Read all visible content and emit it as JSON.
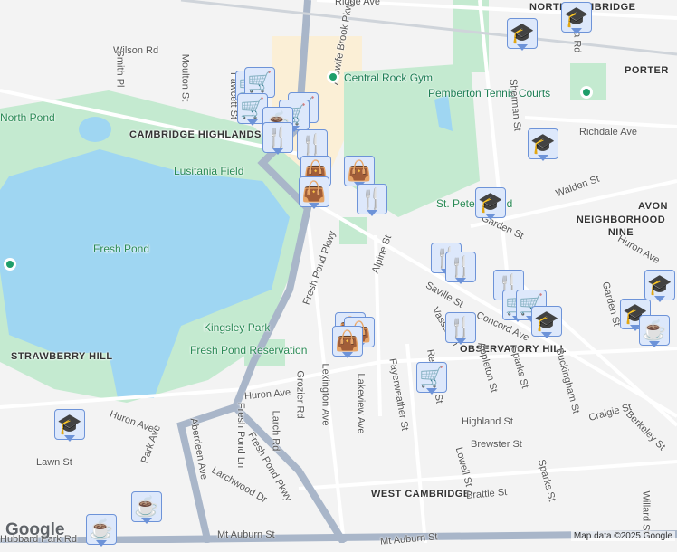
{
  "labels": {
    "areas": [
      "NORTH CAMBRIDGE",
      "PORTER",
      "CAMBRIDGE HIGHLANDS",
      "AVON",
      "NEIGHBORHOOD NINE",
      "STRAWBERRY HILL",
      "OBSERVATORY HILL",
      "WEST CAMBRIDGE"
    ],
    "parks": [
      "North Pond",
      "Lusitania Field",
      "Fresh Pond",
      "Kingsley Park",
      "Fresh Pond Reservation",
      "St. Peter's Field"
    ],
    "pois": [
      "Central Rock Gym",
      "Pemberton Tennis Courts"
    ],
    "streets": [
      "Wilson Rd",
      "Smith Pl",
      "Moulton St",
      "Fawcett St",
      "Alewife Brook Pkwy",
      "Ridge Ave",
      "Yerxa Rd",
      "Richdale Ave",
      "Sherman St",
      "Walden St",
      "Garden St",
      "Huron Ave",
      "Fresh Pond Pkwy",
      "Alpine St",
      "Saville St",
      "Concord Ave",
      "Vassal Ln",
      "Appleton St",
      "Sparks St",
      "Buckingham St",
      "Garden St",
      "Huron Ave",
      "Grozier Rd",
      "Lexington Ave",
      "Lakeview Ave",
      "Fayerweather St",
      "Reservoir St",
      "Highland St",
      "Brewster St",
      "Craigie St",
      "Berkeley St",
      "Huron Ave",
      "Larch Rd",
      "Fresh Pond Ln",
      "Park Ave",
      "Lawn St",
      "Aberdeen Ave",
      "Fresh Pond Pkwy",
      "Larchwood Dr",
      "Brattle St",
      "Lowell St",
      "Sparks St",
      "Willard St",
      "Mt Auburn St",
      "Mt Auburn St",
      "Hubbard Park Rd"
    ]
  },
  "markers": [
    "grocery",
    "grocery",
    "grocery",
    "grocery",
    "grocery",
    "coffee",
    "restaurant",
    "restaurant",
    "shopping",
    "shopping",
    "shopping",
    "restaurant",
    "restaurant",
    "restaurant",
    "restaurant",
    "grocery",
    "grocery",
    "shopping",
    "shopping",
    "shopping",
    "restaurant",
    "grocery",
    "education",
    "education",
    "education",
    "education",
    "education",
    "education",
    "education",
    "coffee",
    "education",
    "coffee",
    "coffee"
  ],
  "icons": {
    "grocery": "🛒",
    "coffee": "☕",
    "restaurant": "🍴",
    "shopping": "👜",
    "education": "🎓"
  },
  "logo": "Google",
  "attribution": "Map data ©2025 Google",
  "colors": {
    "water": "#9fd6f2",
    "park": "#c4ead0",
    "commercial": "#fbefd6",
    "road": "#ffffff",
    "highway": "#a9b6c9",
    "marker_fill": "#dde8fb",
    "marker_icon": "#0d4770"
  }
}
